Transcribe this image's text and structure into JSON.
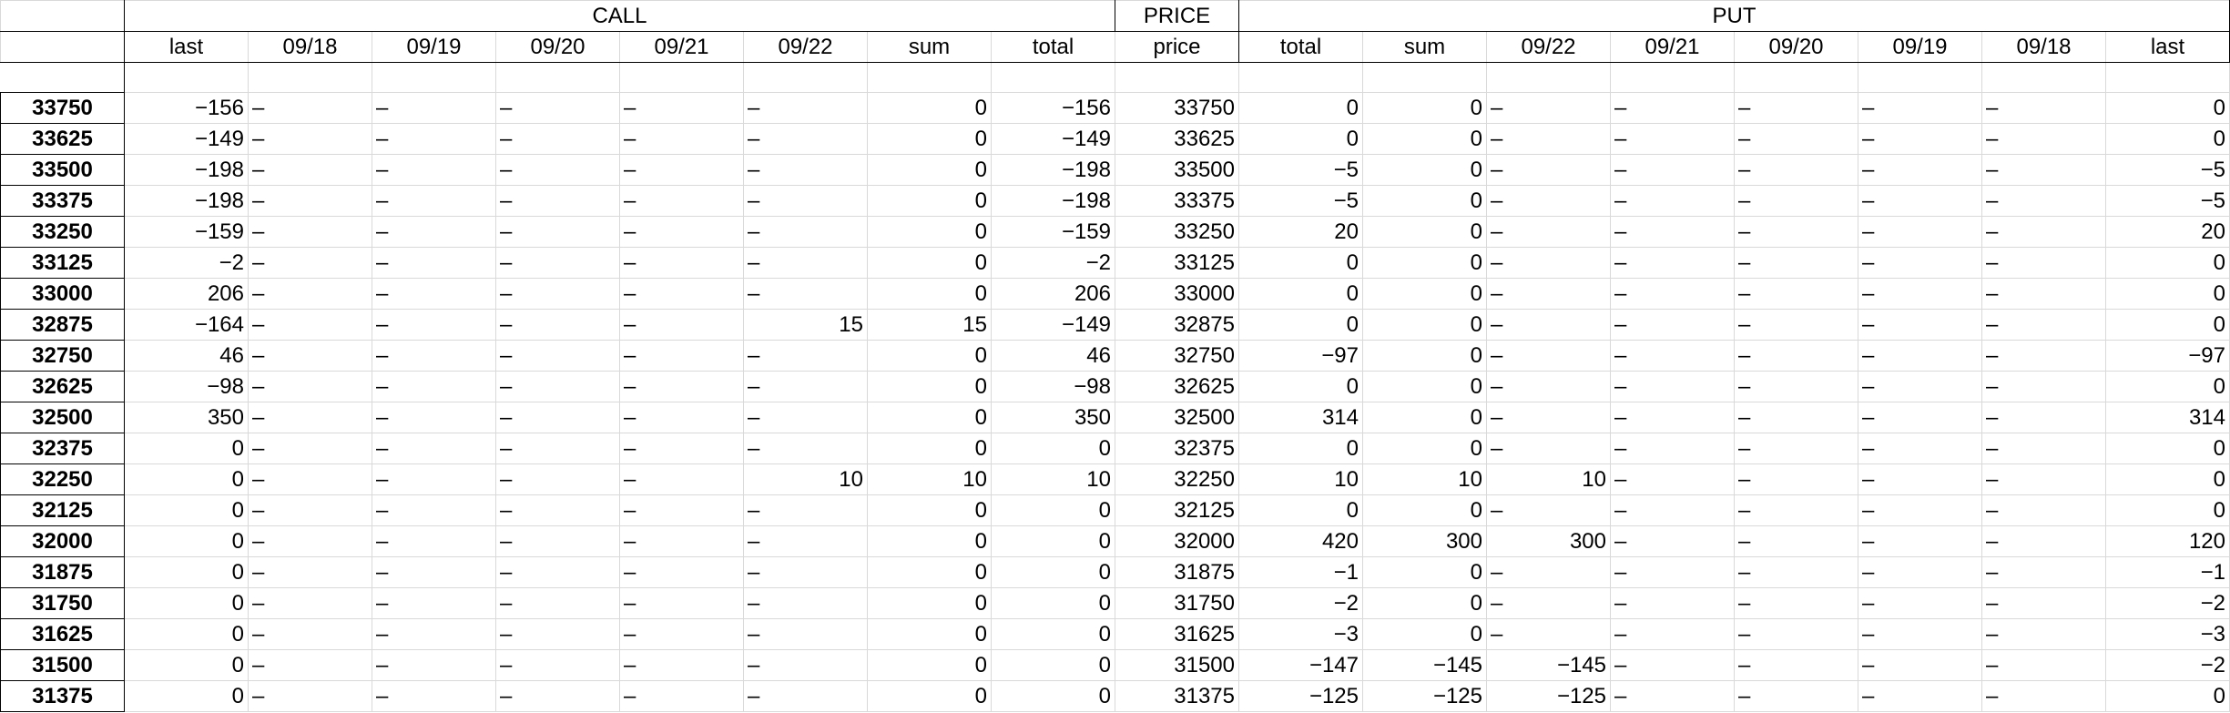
{
  "groups": {
    "call": "CALL",
    "price": "PRICE",
    "put": "PUT"
  },
  "call_headers": [
    "last",
    "09/18",
    "09/19",
    "09/20",
    "09/21",
    "09/22",
    "sum",
    "total"
  ],
  "price_header": "price",
  "put_headers": [
    "total",
    "sum",
    "09/22",
    "09/21",
    "09/20",
    "09/19",
    "09/18",
    "last"
  ],
  "rows": [
    {
      "label": "33750",
      "call": [
        "−156",
        "–",
        "–",
        "–",
        "–",
        "–",
        "0",
        "−156"
      ],
      "price": "33750",
      "put": [
        "0",
        "0",
        "–",
        "–",
        "–",
        "–",
        "–",
        "0"
      ]
    },
    {
      "label": "33625",
      "call": [
        "−149",
        "–",
        "–",
        "–",
        "–",
        "–",
        "0",
        "−149"
      ],
      "price": "33625",
      "put": [
        "0",
        "0",
        "–",
        "–",
        "–",
        "–",
        "–",
        "0"
      ]
    },
    {
      "label": "33500",
      "call": [
        "−198",
        "–",
        "–",
        "–",
        "–",
        "–",
        "0",
        "−198"
      ],
      "price": "33500",
      "put": [
        "−5",
        "0",
        "–",
        "–",
        "–",
        "–",
        "–",
        "−5"
      ]
    },
    {
      "label": "33375",
      "call": [
        "−198",
        "–",
        "–",
        "–",
        "–",
        "–",
        "0",
        "−198"
      ],
      "price": "33375",
      "put": [
        "−5",
        "0",
        "–",
        "–",
        "–",
        "–",
        "–",
        "−5"
      ]
    },
    {
      "label": "33250",
      "call": [
        "−159",
        "–",
        "–",
        "–",
        "–",
        "–",
        "0",
        "−159"
      ],
      "price": "33250",
      "put": [
        "20",
        "0",
        "–",
        "–",
        "–",
        "–",
        "–",
        "20"
      ]
    },
    {
      "label": "33125",
      "call": [
        "−2",
        "–",
        "–",
        "–",
        "–",
        "–",
        "0",
        "−2"
      ],
      "price": "33125",
      "put": [
        "0",
        "0",
        "–",
        "–",
        "–",
        "–",
        "–",
        "0"
      ]
    },
    {
      "label": "33000",
      "call": [
        "206",
        "–",
        "–",
        "–",
        "–",
        "–",
        "0",
        "206"
      ],
      "price": "33000",
      "put": [
        "0",
        "0",
        "–",
        "–",
        "–",
        "–",
        "–",
        "0"
      ]
    },
    {
      "label": "32875",
      "call": [
        "−164",
        "–",
        "–",
        "–",
        "–",
        "15",
        "15",
        "−149"
      ],
      "price": "32875",
      "put": [
        "0",
        "0",
        "–",
        "–",
        "–",
        "–",
        "–",
        "0"
      ]
    },
    {
      "label": "32750",
      "call": [
        "46",
        "–",
        "–",
        "–",
        "–",
        "–",
        "0",
        "46"
      ],
      "price": "32750",
      "put": [
        "−97",
        "0",
        "–",
        "–",
        "–",
        "–",
        "–",
        "−97"
      ]
    },
    {
      "label": "32625",
      "call": [
        "−98",
        "–",
        "–",
        "–",
        "–",
        "–",
        "0",
        "−98"
      ],
      "price": "32625",
      "put": [
        "0",
        "0",
        "–",
        "–",
        "–",
        "–",
        "–",
        "0"
      ]
    },
    {
      "label": "32500",
      "call": [
        "350",
        "–",
        "–",
        "–",
        "–",
        "–",
        "0",
        "350"
      ],
      "price": "32500",
      "put": [
        "314",
        "0",
        "–",
        "–",
        "–",
        "–",
        "–",
        "314"
      ]
    },
    {
      "label": "32375",
      "call": [
        "0",
        "–",
        "–",
        "–",
        "–",
        "–",
        "0",
        "0"
      ],
      "price": "32375",
      "put": [
        "0",
        "0",
        "–",
        "–",
        "–",
        "–",
        "–",
        "0"
      ]
    },
    {
      "label": "32250",
      "call": [
        "0",
        "–",
        "–",
        "–",
        "–",
        "10",
        "10",
        "10"
      ],
      "price": "32250",
      "put": [
        "10",
        "10",
        "10",
        "–",
        "–",
        "–",
        "–",
        "0"
      ]
    },
    {
      "label": "32125",
      "call": [
        "0",
        "–",
        "–",
        "–",
        "–",
        "–",
        "0",
        "0"
      ],
      "price": "32125",
      "put": [
        "0",
        "0",
        "–",
        "–",
        "–",
        "–",
        "–",
        "0"
      ]
    },
    {
      "label": "32000",
      "call": [
        "0",
        "–",
        "–",
        "–",
        "–",
        "–",
        "0",
        "0"
      ],
      "price": "32000",
      "put": [
        "420",
        "300",
        "300",
        "–",
        "–",
        "–",
        "–",
        "120"
      ]
    },
    {
      "label": "31875",
      "call": [
        "0",
        "–",
        "–",
        "–",
        "–",
        "–",
        "0",
        "0"
      ],
      "price": "31875",
      "put": [
        "−1",
        "0",
        "–",
        "–",
        "–",
        "–",
        "–",
        "−1"
      ]
    },
    {
      "label": "31750",
      "call": [
        "0",
        "–",
        "–",
        "–",
        "–",
        "–",
        "0",
        "0"
      ],
      "price": "31750",
      "put": [
        "−2",
        "0",
        "–",
        "–",
        "–",
        "–",
        "–",
        "−2"
      ]
    },
    {
      "label": "31625",
      "call": [
        "0",
        "–",
        "–",
        "–",
        "–",
        "–",
        "0",
        "0"
      ],
      "price": "31625",
      "put": [
        "−3",
        "0",
        "–",
        "–",
        "–",
        "–",
        "–",
        "−3"
      ]
    },
    {
      "label": "31500",
      "call": [
        "0",
        "–",
        "–",
        "–",
        "–",
        "–",
        "0",
        "0"
      ],
      "price": "31500",
      "put": [
        "−147",
        "−145",
        "−145",
        "–",
        "–",
        "–",
        "–",
        "−2"
      ]
    },
    {
      "label": "31375",
      "call": [
        "0",
        "–",
        "–",
        "–",
        "–",
        "–",
        "0",
        "0"
      ],
      "price": "31375",
      "put": [
        "−125",
        "−125",
        "−125",
        "–",
        "–",
        "–",
        "–",
        "0"
      ]
    }
  ]
}
